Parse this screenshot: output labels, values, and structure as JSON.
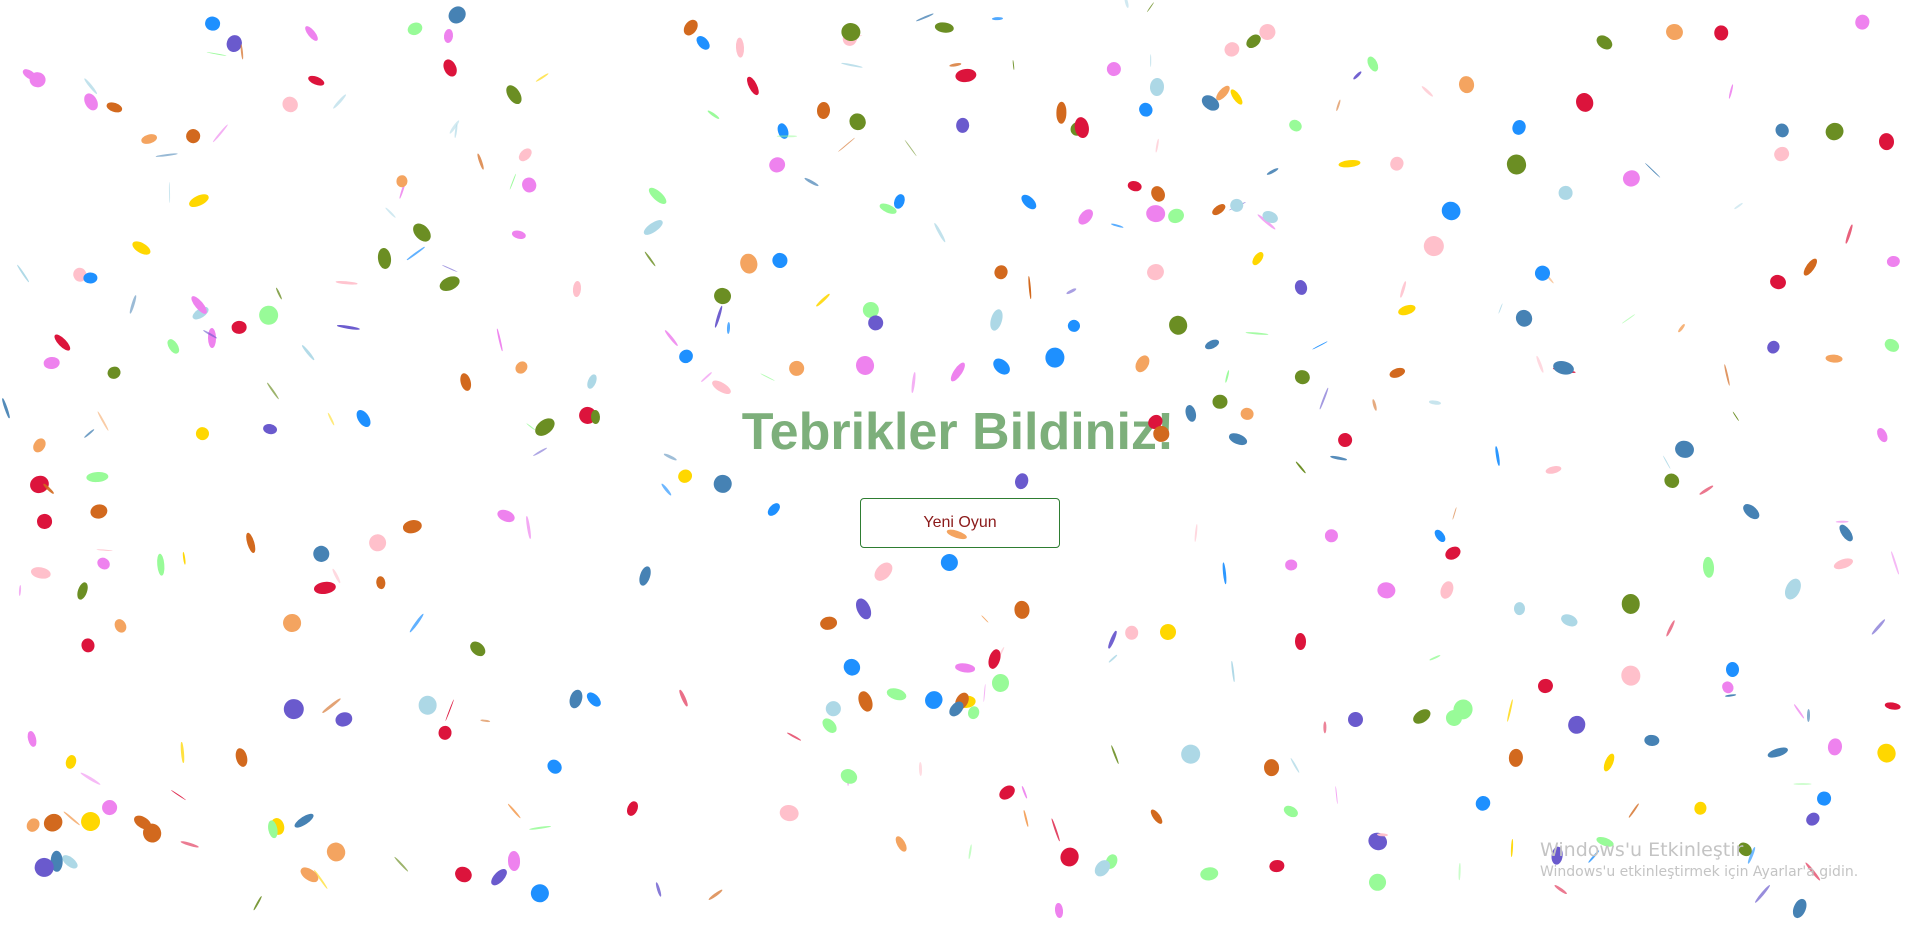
{
  "main": {
    "title": "Tebrikler Bildiniz!",
    "new_game_label": "Yeni Oyun"
  },
  "watermark": {
    "title": "Windows'u Etkinleştir",
    "subtitle": "Windows'u etkinleştirmek için Ayarlar'a gidin."
  },
  "colors": {
    "title": "#7daf7b",
    "button_text": "#8b1a1a",
    "button_border": "#2e7d32",
    "confetti": [
      "#f4a460",
      "#ee82ee",
      "#6a5acd",
      "#ffd700",
      "#1e90ff",
      "#6b8e23",
      "#d2691e",
      "#add8e6",
      "#98fb98",
      "#dc143c",
      "#ffc0cb",
      "#4682b4"
    ]
  }
}
